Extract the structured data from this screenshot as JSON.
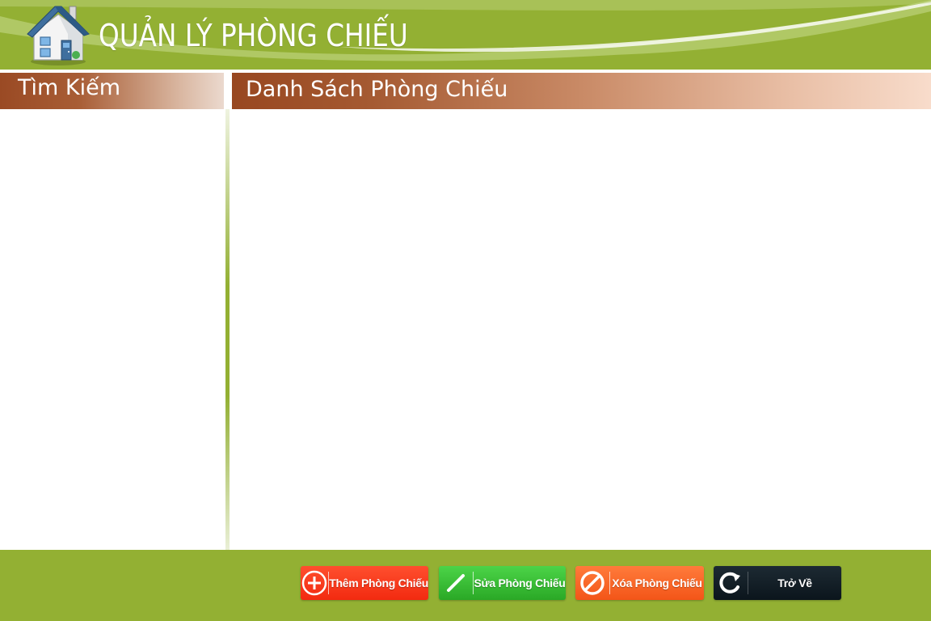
{
  "header": {
    "title": "QUẢN LÝ PHÒNG CHIẾU",
    "icon": "house-icon",
    "background_color": "#93b033"
  },
  "search_panel": {
    "title": "Tìm Kiếm"
  },
  "list_panel": {
    "title": "Danh Sách Phòng Chiếu"
  },
  "footer": {
    "buttons": {
      "add": {
        "label": "Thêm Phòng Chiếu",
        "icon": "plus-circle-icon",
        "color": "#f22a10"
      },
      "edit": {
        "label": "Sửa Phòng Chiếu",
        "icon": "pencil-icon",
        "color": "#2aa826"
      },
      "delete": {
        "label": "Xóa Phòng Chiếu",
        "icon": "prohibited-icon",
        "color": "#f35518"
      },
      "back": {
        "label": "Trở Về",
        "icon": "refresh-icon",
        "color": "#0b151c"
      }
    }
  }
}
